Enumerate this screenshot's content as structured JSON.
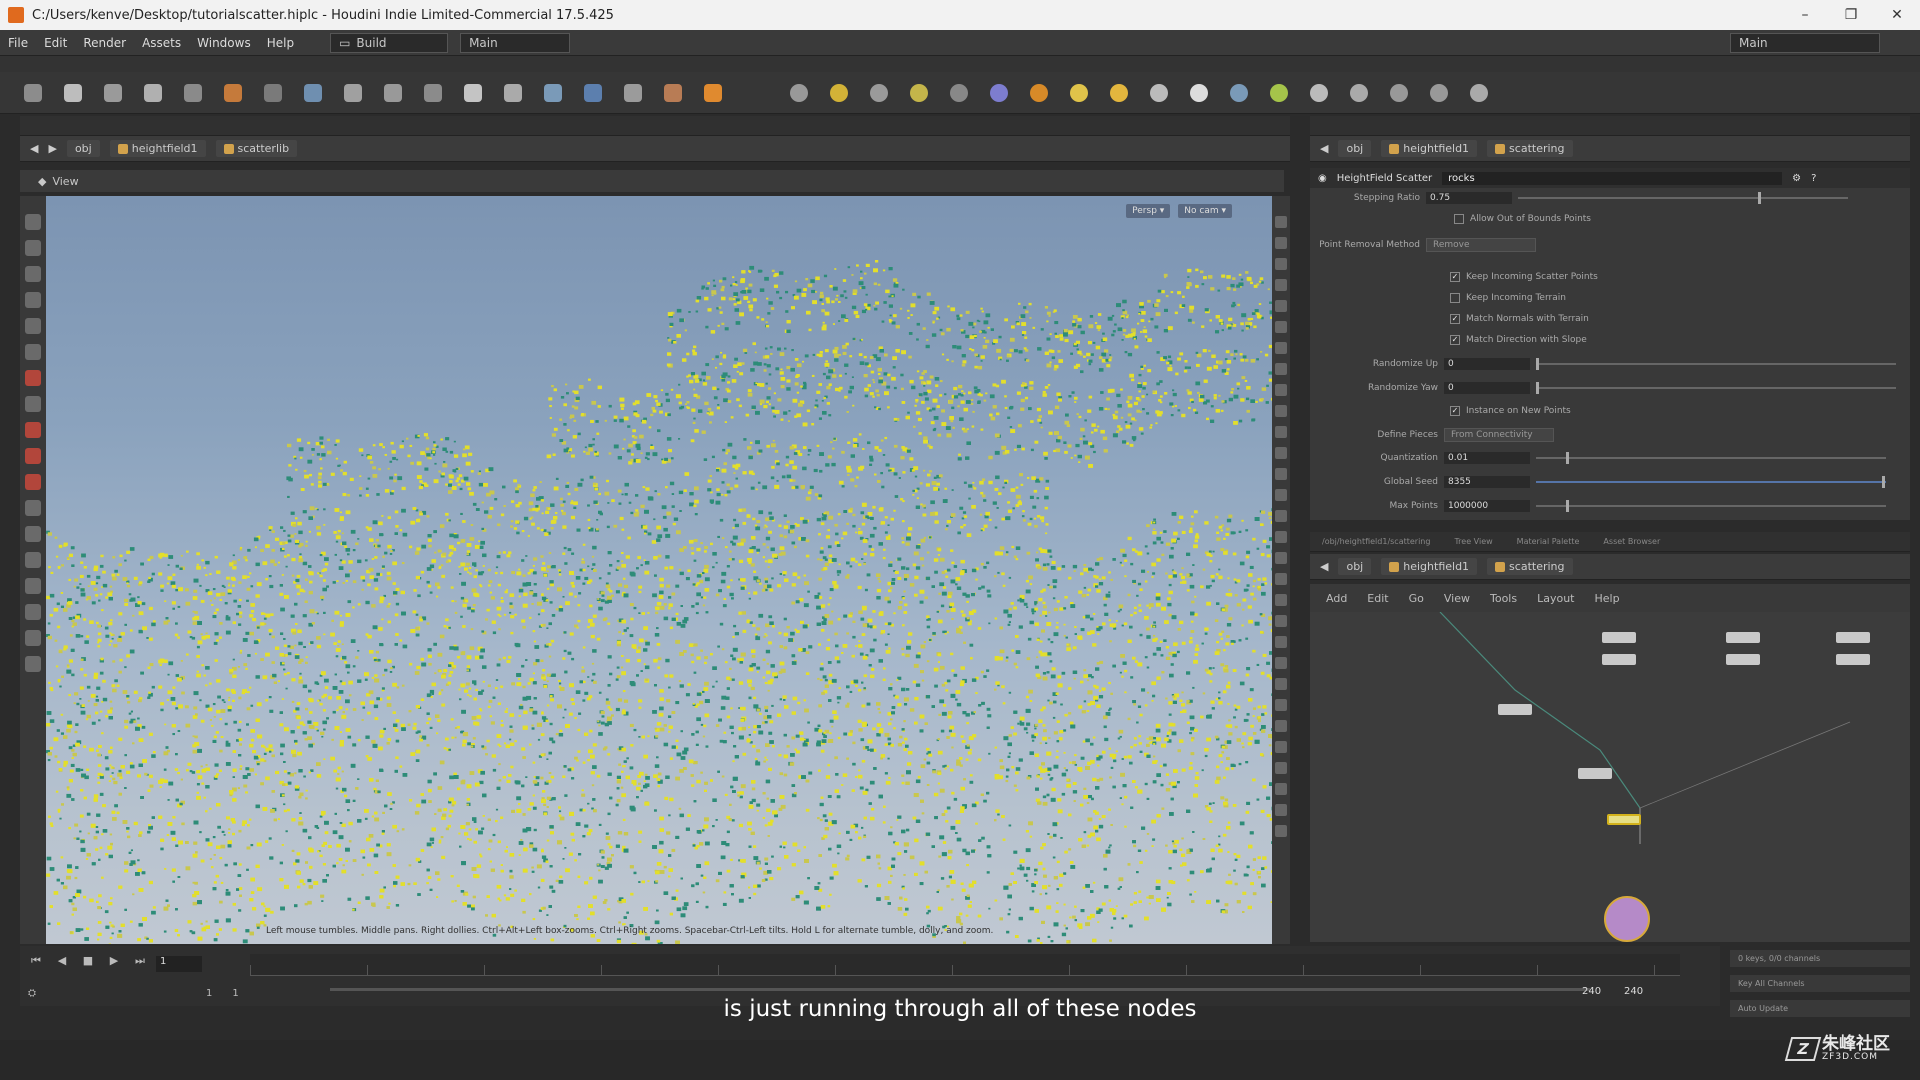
{
  "window": {
    "title": "C:/Users/kenve/Desktop/tutorialscatter.hiplc - Houdini Indie Limited-Commercial 17.5.425",
    "controls": [
      "–",
      "❐",
      "✕"
    ]
  },
  "menubar": {
    "items": [
      "File",
      "Edit",
      "Render",
      "Assets",
      "Windows",
      "Help"
    ],
    "desktop": "Build",
    "desktop_right": "Main",
    "main_right": "Main"
  },
  "viewport": {
    "header_label": "View",
    "path": {
      "root": "obj",
      "node1": "heightfield1",
      "node2": "scatterlib"
    },
    "badges": [
      "Persp ▾",
      "No cam ▾"
    ],
    "hint": "Left mouse tumbles. Middle pans. Right dollies. Ctrl+Alt+Left box-zooms. Ctrl+Right zooms. Spacebar-Ctrl-Left tilts. Hold L for alternate tumble, dolly, and zoom."
  },
  "timeline": {
    "current_frame": "1",
    "range_start": "1",
    "range_start2": "1",
    "end_frame": "240",
    "end_frame2": "240",
    "keys_status": "0 keys, 0/0 channels",
    "key_all": "Key All Channels",
    "auto_update": "Auto Update"
  },
  "params": {
    "node_type": "HeightField Scatter",
    "node_name": "rocks",
    "path": {
      "root": "obj",
      "node1": "heightfield1",
      "node2": "scattering"
    },
    "rows": {
      "stepping_ratio": {
        "label": "Stepping Ratio",
        "value": "0.75"
      },
      "allow_out": {
        "label": "Allow Out of Bounds Points"
      },
      "removal": {
        "label": "Point Removal Method",
        "value": "Remove"
      },
      "keep_scatter": {
        "label": "Keep Incoming Scatter Points",
        "checked": "✓"
      },
      "keep_terrain": {
        "label": "Keep Incoming Terrain"
      },
      "match_normals": {
        "label": "Match Normals with Terrain",
        "checked": "✓"
      },
      "match_direction": {
        "label": "Match Direction with Slope",
        "checked": "✓"
      },
      "randomize_up": {
        "label": "Randomize Up",
        "value": "0"
      },
      "randomize_yaw": {
        "label": "Randomize Yaw",
        "value": "0"
      },
      "instance_new": {
        "label": "Instance on New Points",
        "checked": "✓"
      },
      "define_pieces": {
        "label": "Define Pieces",
        "value": "From Connectivity"
      },
      "quantization": {
        "label": "Quantization",
        "value": "0.01"
      },
      "global_seed": {
        "label": "Global Seed",
        "value": "8355"
      },
      "max_points": {
        "label": "Max Points",
        "value": "1000000"
      }
    }
  },
  "network": {
    "tabs": [
      "/obj/heightfield1/scattering",
      "Tree View",
      "Material Palette",
      "Asset Browser"
    ],
    "menu": [
      "Add",
      "Edit",
      "Go",
      "View",
      "Tools",
      "Layout",
      "Help"
    ]
  },
  "subtitle": "is just running through all of these nodes",
  "watermark": {
    "brand": "朱峰社区",
    "domain": "ZF3D.COM",
    "mark": "Z"
  }
}
